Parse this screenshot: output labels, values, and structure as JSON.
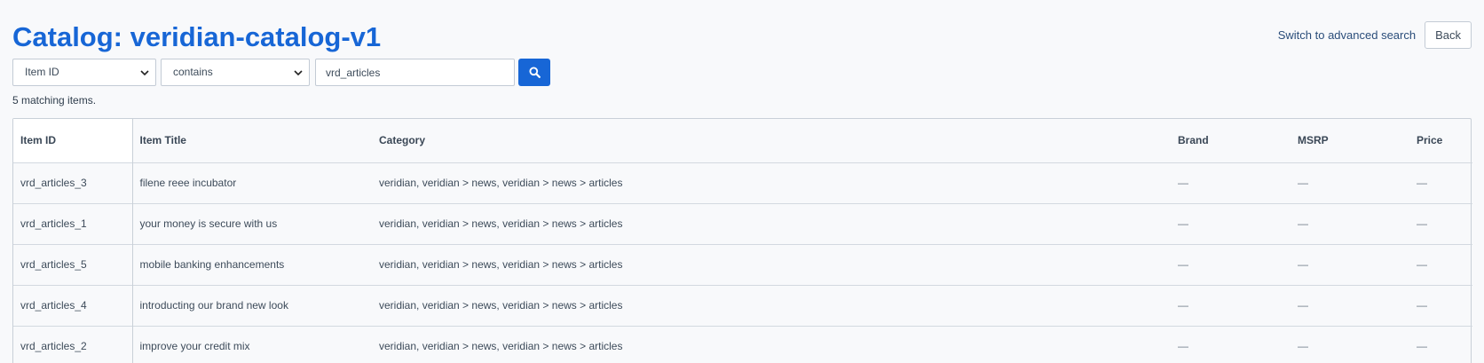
{
  "page": {
    "title": "Catalog: veridian-catalog-v1",
    "advanced_link": "Switch to advanced search",
    "back_label": "Back"
  },
  "filters": {
    "field_value": "Item ID",
    "operator_value": "contains",
    "search_value": "vrd_articles",
    "search_icon": "search-icon",
    "accent_color": "#1766d6"
  },
  "results": {
    "count_text": "5 matching items."
  },
  "table": {
    "headers": {
      "item_id": "Item ID",
      "item_title": "Item Title",
      "category": "Category",
      "brand": "Brand",
      "msrp": "MSRP",
      "price": "Price"
    },
    "rows": [
      {
        "item_id": "vrd_articles_3",
        "item_title": "filene reee incubator",
        "category": "veridian, veridian > news, veridian > news > articles",
        "brand": "—",
        "msrp": "—",
        "price": "—"
      },
      {
        "item_id": "vrd_articles_1",
        "item_title": "your money is secure with us",
        "category": "veridian, veridian > news, veridian > news > articles",
        "brand": "—",
        "msrp": "—",
        "price": "—"
      },
      {
        "item_id": "vrd_articles_5",
        "item_title": "mobile banking enhancements",
        "category": "veridian, veridian > news, veridian > news > articles",
        "brand": "—",
        "msrp": "—",
        "price": "—"
      },
      {
        "item_id": "vrd_articles_4",
        "item_title": "introducting our brand new look",
        "category": "veridian, veridian > news, veridian > news > articles",
        "brand": "—",
        "msrp": "—",
        "price": "—"
      },
      {
        "item_id": "vrd_articles_2",
        "item_title": "improve your credit mix",
        "category": "veridian, veridian > news, veridian > news > articles",
        "brand": "—",
        "msrp": "—",
        "price": "—"
      }
    ]
  }
}
